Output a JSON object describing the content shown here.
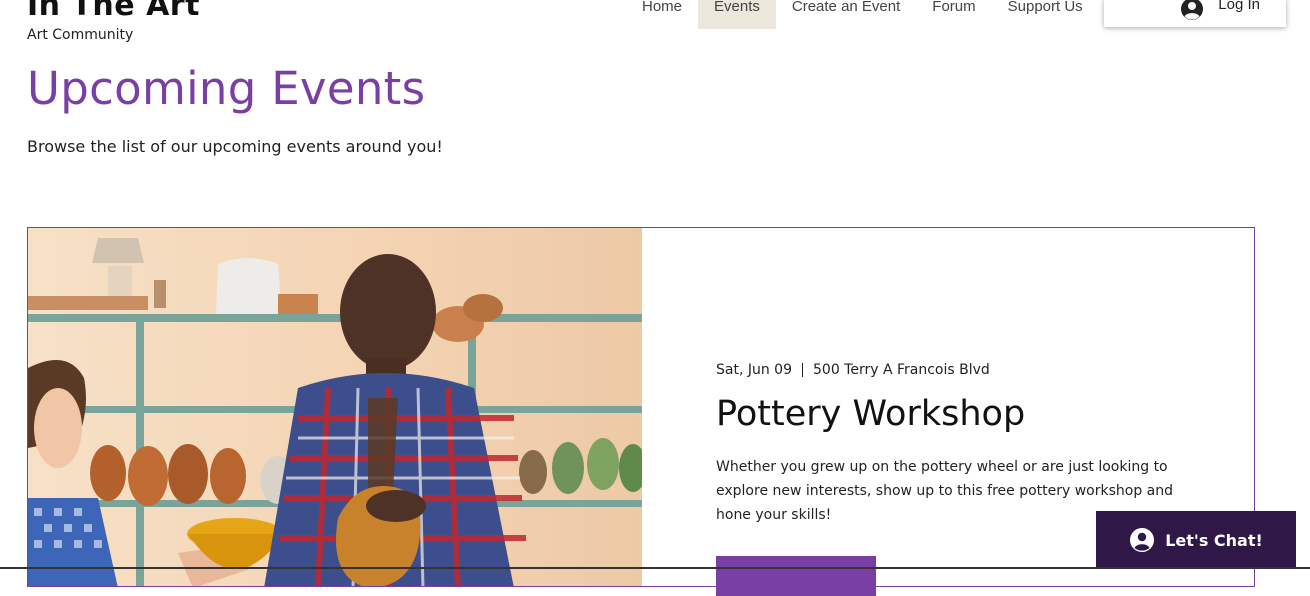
{
  "header": {
    "site_title": "In The Art",
    "tagline": "Art Community",
    "nav": [
      {
        "label": "Home"
      },
      {
        "label": "Events",
        "active": true
      },
      {
        "label": "Create an Event"
      },
      {
        "label": "Forum"
      },
      {
        "label": "Support Us"
      }
    ],
    "login": {
      "label": "Log In",
      "icon": "user-avatar-icon"
    }
  },
  "main": {
    "title": "Upcoming Events",
    "subtitle": "Browse the list of our upcoming events around you!"
  },
  "event": {
    "date": "Sat, Jun 09",
    "location": "500 Terry A Francois Blvd",
    "title": "Pottery Workshop",
    "description": "Whether you grew up on the pottery wheel or are just looking to explore new interests, show up to this free pottery workshop and hone your skills!",
    "image": "pottery-workshop-photo"
  },
  "chat": {
    "label": "Let's Chat!",
    "icon": "chat-avatar-icon"
  },
  "colors": {
    "accent": "#7a3fa4",
    "chat_bg": "#2f1847",
    "active_nav_bg": "#ece6dc"
  }
}
